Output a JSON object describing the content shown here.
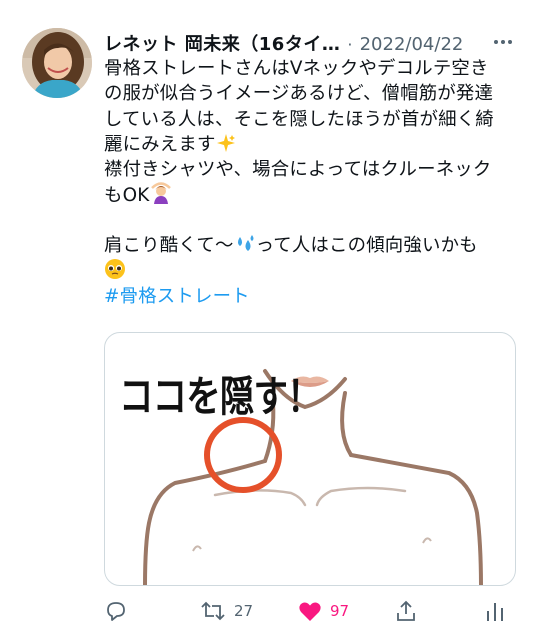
{
  "tweet": {
    "author_name": "レネット 岡未来（16タイ…",
    "separator": "·",
    "date": "2022/04/22",
    "lines": [
      "骨格ストレートさんはVネックやデコルテ空き",
      "の服が似合うイメージあるけど、僧帽筋が発達",
      "している人は、そこを隠したほうが首が細く綺",
      "麗にみえます",
      "襟付きシャツや、場合によってはクルーネック",
      "もOK",
      "肩こり酷くて〜",
      "って人はこの傾向強いかも"
    ],
    "hashtag": "#骨格ストレート",
    "media_caption": "ココを隠す！"
  },
  "actions": {
    "reply_icon": "reply-icon",
    "retweet_icon": "retweet-icon",
    "retweet_count": "27",
    "like_icon": "heart-icon",
    "like_count": "97",
    "share_icon": "share-icon",
    "analytics_icon": "analytics-icon"
  },
  "colors": {
    "text": "#0f1419",
    "secondary": "#536471",
    "link": "#1d9bf0",
    "like": "#f91880",
    "circle": "#e5502a",
    "body_outline": "#9b7866"
  }
}
